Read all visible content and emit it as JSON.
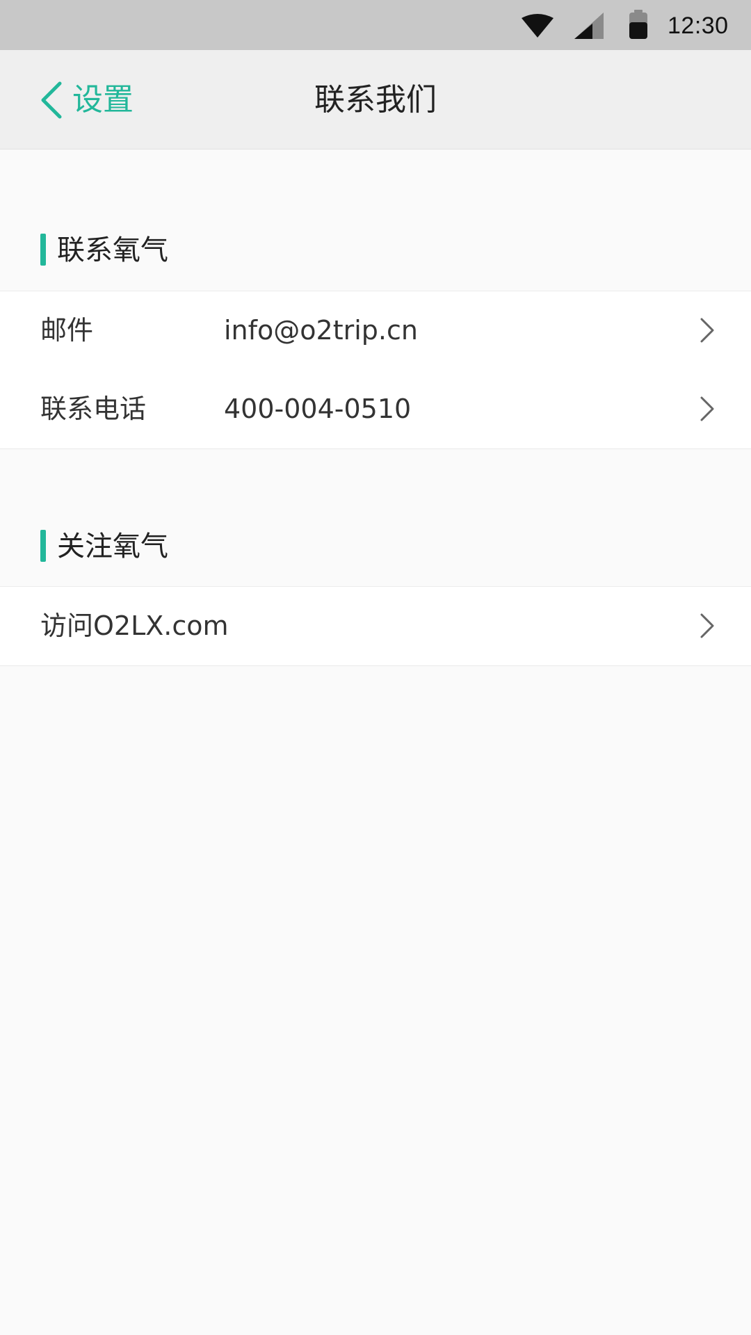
{
  "status_bar": {
    "time": "12:30",
    "icons": [
      "wifi-icon",
      "cell-signal-icon",
      "battery-icon"
    ]
  },
  "nav": {
    "back_label": "设置",
    "title": "联系我们"
  },
  "colors": {
    "accent": "#22b79a",
    "status_bar_bg": "#c8c8c8",
    "nav_bg": "#efefef",
    "page_bg": "#fafafa"
  },
  "sections": [
    {
      "title": "联系氧气",
      "rows": [
        {
          "label": "邮件",
          "value": "info@o2trip.cn"
        },
        {
          "label": "联系电话",
          "value": "400-004-0510"
        }
      ]
    },
    {
      "title": "关注氧气",
      "rows": [
        {
          "label": "访问O2LX.com"
        }
      ]
    }
  ]
}
